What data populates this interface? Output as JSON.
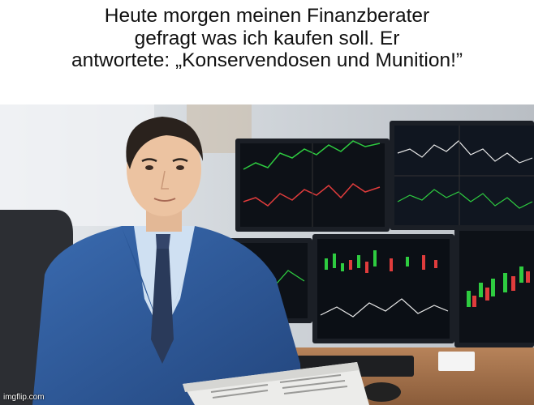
{
  "meme": {
    "caption_lines": [
      "Heute morgen meinen Finanzberater",
      "gefragt was ich kaufen soll. Er",
      "antwortete: „Konservendosen und Munition!”"
    ],
    "watermark": "imgflip.com"
  },
  "photo": {
    "subject": "man in blue suit with newspaper in front of trading monitors",
    "colors": {
      "suit": "#2f5d9e",
      "tie": "#2a3a5a",
      "shirt": "#cfe0f2",
      "background": "#d9dde2",
      "screen": "#0d1117",
      "candle_up": "#2ecc40",
      "candle_down": "#e03c3c"
    }
  }
}
